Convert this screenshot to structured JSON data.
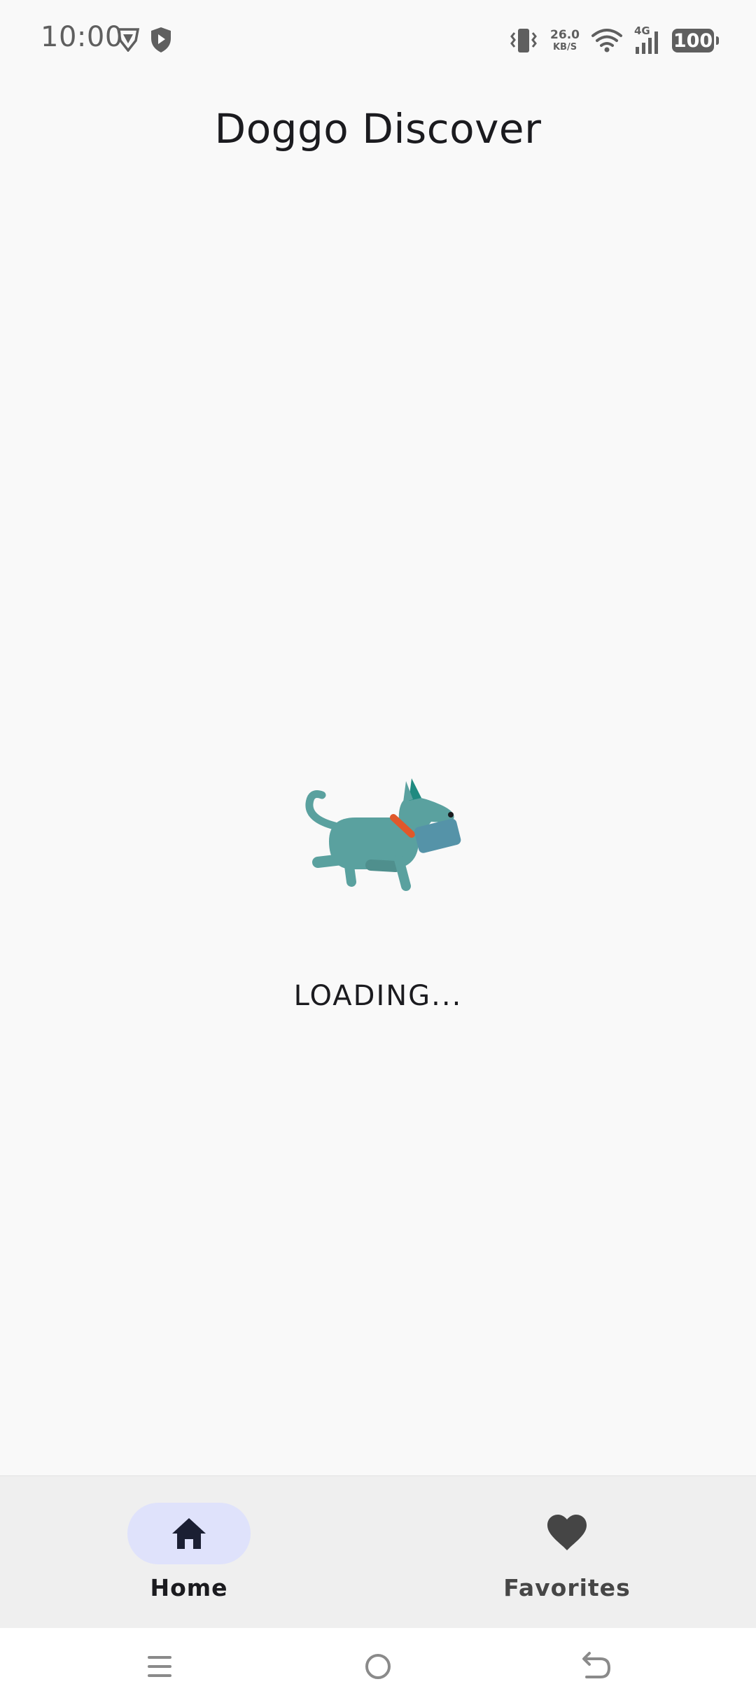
{
  "status_bar": {
    "time": "10:00",
    "net_speed_value": "26.0",
    "net_speed_unit": "KB/S",
    "network_type": "4G",
    "battery": "100",
    "icons": [
      "vpn-key-icon",
      "shield-play-icon",
      "vibrate-icon",
      "wifi-icon",
      "signal-icon",
      "battery-icon"
    ]
  },
  "app": {
    "title": "Doggo Discover"
  },
  "loading": {
    "text": "LOADING...",
    "illustration": "dog-carrying-mail-icon",
    "colors": {
      "dog": "#5aa19f",
      "ear": "#1f8a80",
      "collar": "#e0582b",
      "envelope": "#5593a8"
    }
  },
  "bottom_nav": {
    "items": [
      {
        "label": "Home",
        "icon": "home-icon",
        "selected": true
      },
      {
        "label": "Favorites",
        "icon": "heart-icon",
        "selected": false
      }
    ],
    "colors": {
      "background": "#efefef",
      "active_pill": "#dfe2fb",
      "active_icon": "#1b1f33",
      "inactive_icon": "#454545"
    }
  },
  "system_nav": {
    "buttons": [
      "menu-icon",
      "home-circle-icon",
      "back-icon"
    ]
  }
}
